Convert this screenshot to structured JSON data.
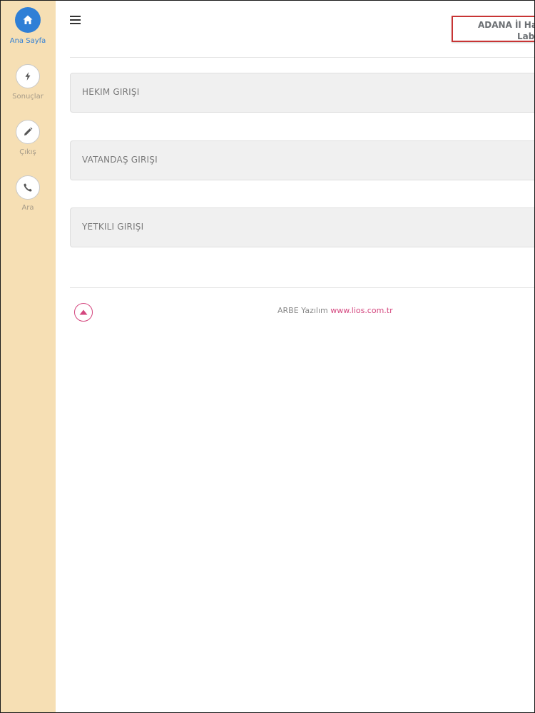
{
  "sidebar": {
    "items": [
      {
        "label": "Ana Sayfa",
        "icon": "home-icon",
        "active": true
      },
      {
        "label": "Sonuçlar",
        "icon": "lightning-icon",
        "active": false
      },
      {
        "label": "Çıkış",
        "icon": "pencil-icon",
        "active": false
      },
      {
        "label": "Ara",
        "icon": "phone-icon",
        "active": false
      }
    ]
  },
  "header": {
    "menu_icon": "hamburger-icon",
    "title_line1": "ADANA İl Hal",
    "title_line2": "Labo"
  },
  "login_options": [
    {
      "label": "HEKIM GIRIŞI"
    },
    {
      "label": "VATANDAŞ GIRIŞI"
    },
    {
      "label": "YETKILI GIRIŞI"
    }
  ],
  "footer": {
    "company": "ARBE Yazılım",
    "link": "www.lios.com.tr",
    "scroll_top_icon": "arrow-up-icon"
  },
  "colors": {
    "sidebar_bg": "#f6dfb4",
    "active_blue": "#2f7fd6",
    "accent_pink": "#d4467e",
    "header_border": "#c83434"
  }
}
